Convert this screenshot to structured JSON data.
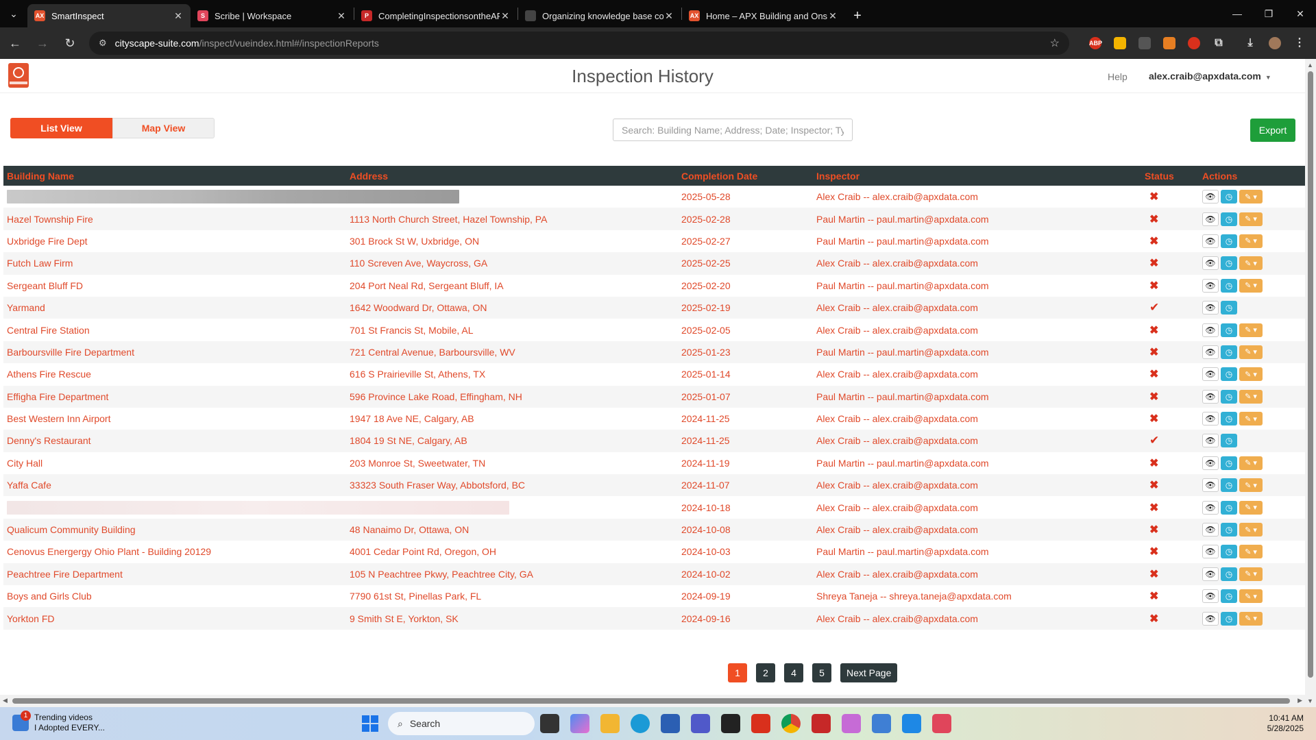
{
  "browser": {
    "tabs": [
      {
        "title": "SmartInspect",
        "favicon": "AX",
        "color": "#e2522e",
        "active": true
      },
      {
        "title": "Scribe | Workspace",
        "favicon": "S",
        "color": "#e0455b",
        "active": false
      },
      {
        "title": "CompletingInspectionsontheAP",
        "favicon": "P",
        "color": "#c62828",
        "active": false
      },
      {
        "title": "Organizing knowledge base co",
        "favicon": "",
        "color": "#444444",
        "active": false
      },
      {
        "title": "Home – APX Building and Onsit",
        "favicon": "AX",
        "color": "#e2522e",
        "active": false
      }
    ],
    "url_host": "cityscape-suite.com",
    "url_path": "/inspect/vueindex.html#/inspectionReports"
  },
  "app": {
    "title": "Inspection History",
    "help": "Help",
    "user": "alex.craib@apxdata.com",
    "list_view": "List View",
    "map_view": "Map View",
    "search_placeholder": "Search: Building Name; Address; Date; Inspector; Type",
    "export": "Export"
  },
  "table": {
    "headers": {
      "building": "Building Name",
      "address": "Address",
      "date": "Completion Date",
      "inspector": "Inspector",
      "status": "Status",
      "actions": "Actions"
    },
    "rows": [
      {
        "building": "",
        "address": "",
        "date": "2025-05-28",
        "inspector": "Alex Craib -- alex.craib@apxdata.com",
        "status": "✖",
        "editable": true,
        "redacted": true
      },
      {
        "building": "Hazel Township Fire",
        "address": "1113 North Church Street, Hazel Township, PA",
        "date": "2025-02-28",
        "inspector": "Paul Martin -- paul.martin@apxdata.com",
        "status": "✖",
        "editable": true
      },
      {
        "building": "Uxbridge Fire Dept",
        "address": "301 Brock St W, Uxbridge, ON",
        "date": "2025-02-27",
        "inspector": "Paul Martin -- paul.martin@apxdata.com",
        "status": "✖",
        "editable": true
      },
      {
        "building": "Futch Law Firm",
        "address": "110 Screven Ave, Waycross, GA",
        "date": "2025-02-25",
        "inspector": "Alex Craib -- alex.craib@apxdata.com",
        "status": "✖",
        "editable": true
      },
      {
        "building": "Sergeant Bluff FD",
        "address": "204 Port Neal Rd, Sergeant Bluff, IA",
        "date": "2025-02-20",
        "inspector": "Paul Martin -- paul.martin@apxdata.com",
        "status": "✖",
        "editable": true
      },
      {
        "building": "Yarmand",
        "address": "1642 Woodward Dr, Ottawa, ON",
        "date": "2025-02-19",
        "inspector": "Alex Craib -- alex.craib@apxdata.com",
        "status": "✔",
        "editable": false
      },
      {
        "building": "Central Fire Station",
        "address": "701 St Francis St, Mobile, AL",
        "date": "2025-02-05",
        "inspector": "Alex Craib -- alex.craib@apxdata.com",
        "status": "✖",
        "editable": true
      },
      {
        "building": "Barboursville Fire Department",
        "address": "721 Central Avenue, Barboursville, WV",
        "date": "2025-01-23",
        "inspector": "Paul Martin -- paul.martin@apxdata.com",
        "status": "✖",
        "editable": true
      },
      {
        "building": "Athens Fire Rescue",
        "address": "616 S Prairieville St, Athens, TX",
        "date": "2025-01-14",
        "inspector": "Alex Craib -- alex.craib@apxdata.com",
        "status": "✖",
        "editable": true
      },
      {
        "building": "Effigha Fire Department",
        "address": "596 Province Lake Road, Effingham, NH",
        "date": "2025-01-07",
        "inspector": "Paul Martin -- paul.martin@apxdata.com",
        "status": "✖",
        "editable": true
      },
      {
        "building": "Best Western Inn Airport",
        "address": "1947 18 Ave NE, Calgary, AB",
        "date": "2024-11-25",
        "inspector": "Alex Craib -- alex.craib@apxdata.com",
        "status": "✖",
        "editable": true
      },
      {
        "building": "Denny's Restaurant",
        "address": "1804 19 St NE, Calgary, AB",
        "date": "2024-11-25",
        "inspector": "Alex Craib -- alex.craib@apxdata.com",
        "status": "✔",
        "editable": false
      },
      {
        "building": "City Hall",
        "address": "203 Monroe St, Sweetwater, TN",
        "date": "2024-11-19",
        "inspector": "Paul Martin -- paul.martin@apxdata.com",
        "status": "✖",
        "editable": true
      },
      {
        "building": "Yaffa Cafe",
        "address": "33323 South Fraser Way, Abbotsford, BC",
        "date": "2024-11-07",
        "inspector": "Alex Craib -- alex.craib@apxdata.com",
        "status": "✖",
        "editable": true
      },
      {
        "building": "",
        "address": "",
        "date": "2024-10-18",
        "inspector": "Alex Craib -- alex.craib@apxdata.com",
        "status": "✖",
        "editable": true,
        "redacted": true
      },
      {
        "building": "Qualicum Community Building",
        "address": "48 Nanaimo Dr, Ottawa, ON",
        "date": "2024-10-08",
        "inspector": "Alex Craib -- alex.craib@apxdata.com",
        "status": "✖",
        "editable": true
      },
      {
        "building": "Cenovus Energergy Ohio Plant - Building 20129",
        "address": "4001 Cedar Point Rd, Oregon, OH",
        "date": "2024-10-03",
        "inspector": "Paul Martin -- paul.martin@apxdata.com",
        "status": "✖",
        "editable": true
      },
      {
        "building": "Peachtree Fire Department",
        "address": "105 N Peachtree Pkwy, Peachtree City, GA",
        "date": "2024-10-02",
        "inspector": "Alex Craib -- alex.craib@apxdata.com",
        "status": "✖",
        "editable": true
      },
      {
        "building": "Boys and Girls Club",
        "address": "7790 61st St, Pinellas Park, FL",
        "date": "2024-09-19",
        "inspector": "Shreya Taneja -- shreya.taneja@apxdata.com",
        "status": "✖",
        "editable": true
      },
      {
        "building": "Yorkton FD",
        "address": "9 Smith St E, Yorkton, SK",
        "date": "2024-09-16",
        "inspector": "Alex Craib -- alex.craib@apxdata.com",
        "status": "✖",
        "editable": true
      }
    ]
  },
  "pagination": {
    "pages": [
      "1",
      "2",
      "4",
      "5"
    ],
    "current": "1",
    "next": "Next Page"
  },
  "taskbar": {
    "widget_title": "Trending videos",
    "widget_sub": "I Adopted EVERY...",
    "widget_badge": "1",
    "search": "Search",
    "time": "10:41 AM",
    "date": "5/28/2025"
  }
}
